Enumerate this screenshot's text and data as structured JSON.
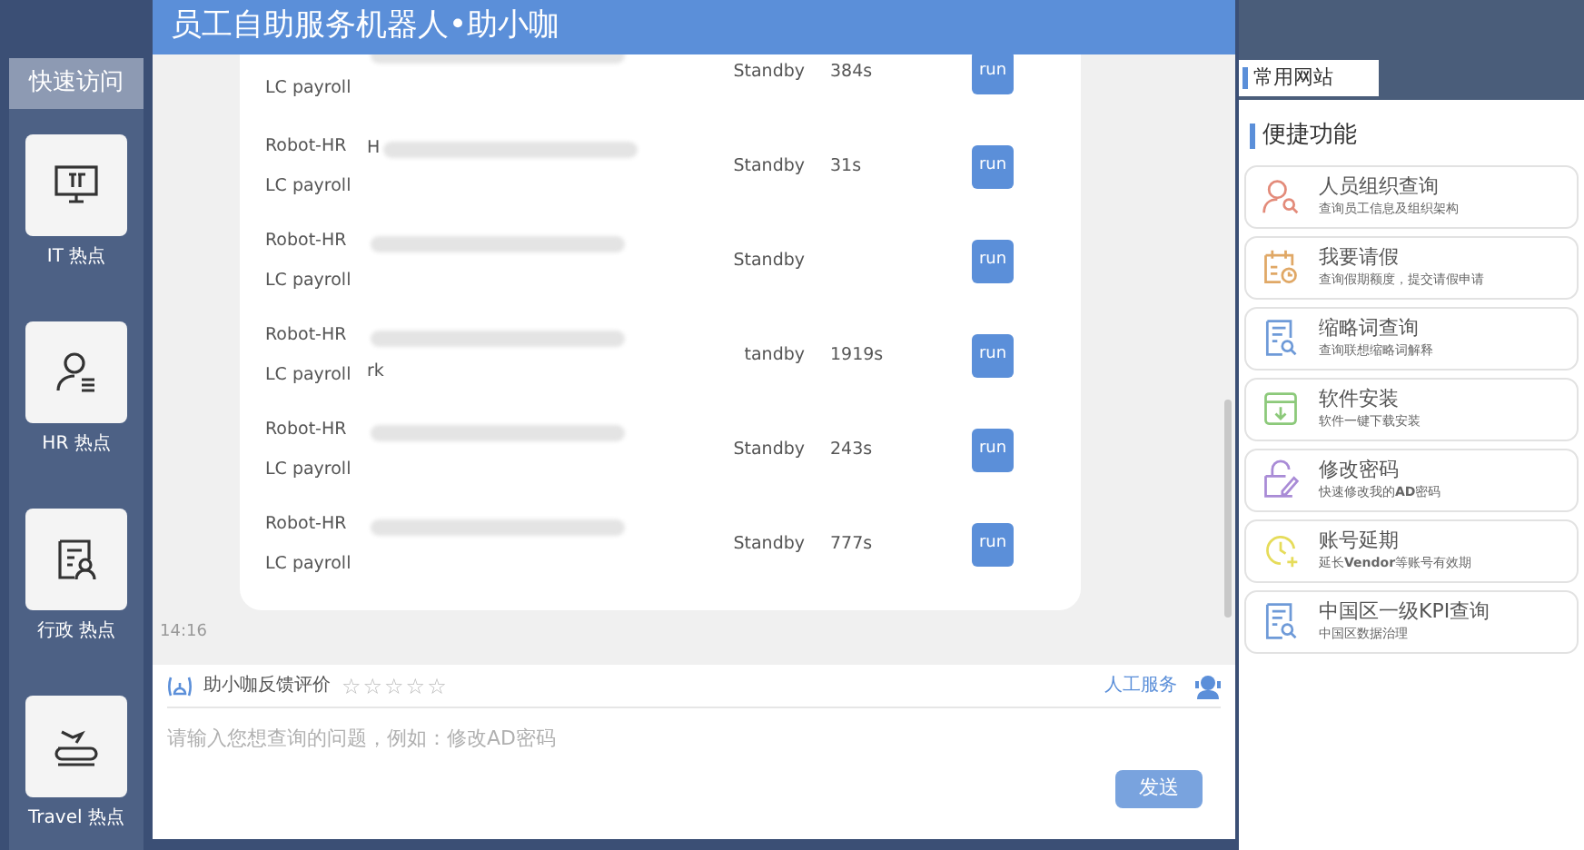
{
  "sidebar": {
    "title": "快速访问",
    "items": [
      {
        "kind": "it",
        "label": "IT 热点"
      },
      {
        "kind": "hr",
        "label": "HR 热点"
      },
      {
        "kind": "admin",
        "label": "行政 热点"
      },
      {
        "kind": "travel",
        "label": "Travel 热点"
      }
    ]
  },
  "header": {
    "title": "员工自助服务机器人•助小咖"
  },
  "messages": {
    "rows": [
      {
        "line_1": null,
        "line_2": "LC payroll",
        "detail_1": "",
        "detail_2": "",
        "status": "Standby",
        "time": "384s",
        "button": "run"
      },
      {
        "line_1": "Robot-HR",
        "line_2": "LC payroll",
        "detail_1": "H",
        "detail_2": "",
        "status": "Standby",
        "time": "31s",
        "button": "run"
      },
      {
        "line_1": "Robot-HR",
        "line_2": "LC payroll",
        "detail_1": "",
        "detail_2": "",
        "status": "Standby",
        "time": "",
        "button": "run"
      },
      {
        "line_1": "Robot-HR",
        "line_2": "LC payroll",
        "detail_1": "",
        "detail_2": "rk",
        "status": "tandby",
        "time": "1919s",
        "button": "run"
      },
      {
        "line_1": "Robot-HR",
        "line_2": "LC payroll",
        "detail_1": "",
        "detail_2": "",
        "status": "Standby",
        "time": "243s",
        "button": "run"
      },
      {
        "line_1": "Robot-HR",
        "line_2": "LC payroll",
        "detail_1": "",
        "detail_2": "",
        "status": "Standby",
        "time": "777s",
        "button": "run"
      }
    ],
    "timestamp": "14:16"
  },
  "feedback": {
    "label": "助小咖反馈评价",
    "stars": 0,
    "human_service": "人工服务"
  },
  "input": {
    "placeholder": "请输入您想查询的问题，例如：修改AD密码",
    "send": "发送"
  },
  "right_panel": {
    "tab": "常用网站",
    "section": "便捷功能",
    "items": [
      {
        "kind": "person",
        "color": "#e38b7a",
        "title": "人员组织查询",
        "subtitle": "查询员工信息及组织架构"
      },
      {
        "kind": "calendar",
        "color": "#e0a866",
        "title": "我要请假",
        "subtitle": "查询假期额度，提交请假申请"
      },
      {
        "kind": "document",
        "color": "#6e9ad8",
        "title": "缩略词查询",
        "subtitle": "查询联想缩略词解释"
      },
      {
        "kind": "download",
        "color": "#8cc97a",
        "title": "软件安装",
        "subtitle": "软件一键下载安装"
      },
      {
        "kind": "edit",
        "color": "#a98bd6",
        "title": "修改密码",
        "subtitle": "快速修改我的**AD**密码"
      },
      {
        "kind": "clock",
        "color": "#e6dc5a",
        "title": "账号延期",
        "subtitle": "延长**Vendor**等账号有效期"
      },
      {
        "kind": "document",
        "color": "#6e9ad8",
        "title": "中国区一级KPI查询",
        "subtitle": "中国区数据治理"
      }
    ]
  }
}
